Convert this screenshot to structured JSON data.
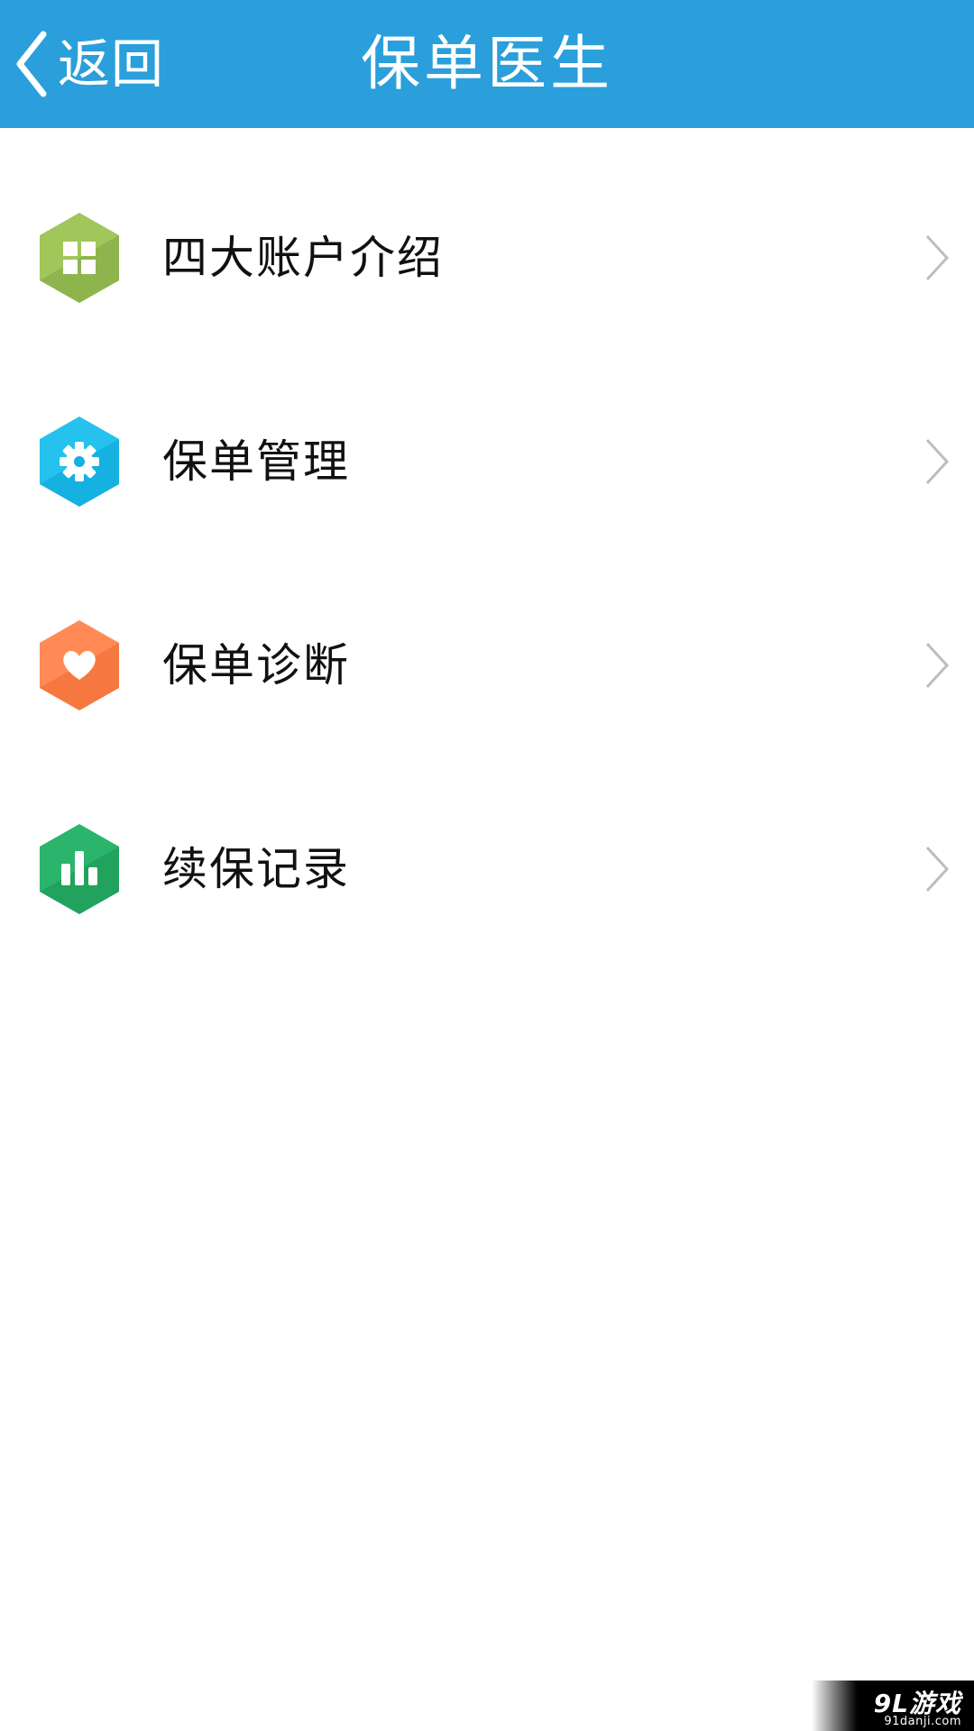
{
  "header": {
    "back_label": "返回",
    "title": "保单医生",
    "background_color": "#2a9fdb"
  },
  "menu": {
    "items": [
      {
        "label": "四大账户介绍",
        "icon": "grid-icon",
        "icon_color": "#8cb84a"
      },
      {
        "label": "保单管理",
        "icon": "gear-icon",
        "icon_color": "#12b0e0"
      },
      {
        "label": "保单诊断",
        "icon": "heart-icon",
        "icon_color": "#ff7a45"
      },
      {
        "label": "续保记录",
        "icon": "bar-chart-icon",
        "icon_color": "#22a862"
      }
    ]
  },
  "watermark": {
    "main": "9L游戏",
    "sub": "91danji.com"
  }
}
